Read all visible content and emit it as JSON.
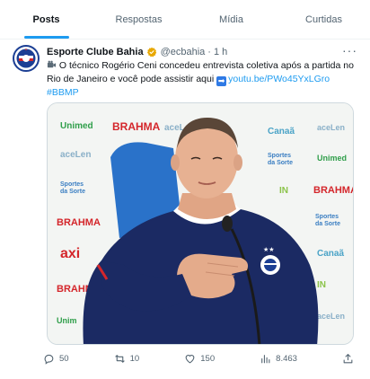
{
  "tabs": [
    {
      "label": "Posts"
    },
    {
      "label": "Respostas"
    },
    {
      "label": "Mídia"
    },
    {
      "label": "Curtidas"
    }
  ],
  "tweet": {
    "name": "Esporte Clube Bahia",
    "handle": "@ecbahia",
    "time": "1 h",
    "text_main": " O técnico Rogério Ceni concedeu entrevista coletiva após a partida no Rio de Janeiro e você pode assistir aqui ",
    "link": "youtu.be/PWo45YxLGro",
    "hashtag": "#BBMP",
    "replies": "50",
    "retweets": "10",
    "likes": "150",
    "views": "8.463"
  },
  "media": {
    "sponsors": [
      "Unimed",
      "BRAHMA",
      "aceLen",
      "Canaã",
      "Sportes da Sorte",
      "axi",
      "Unimed"
    ],
    "shirt_color": "#1b2a63"
  },
  "colors": {
    "accent": "#1d9bf0",
    "text_secondary": "#536471",
    "brahma_red": "#d4262b",
    "unimed_green": "#2f9e4a"
  }
}
